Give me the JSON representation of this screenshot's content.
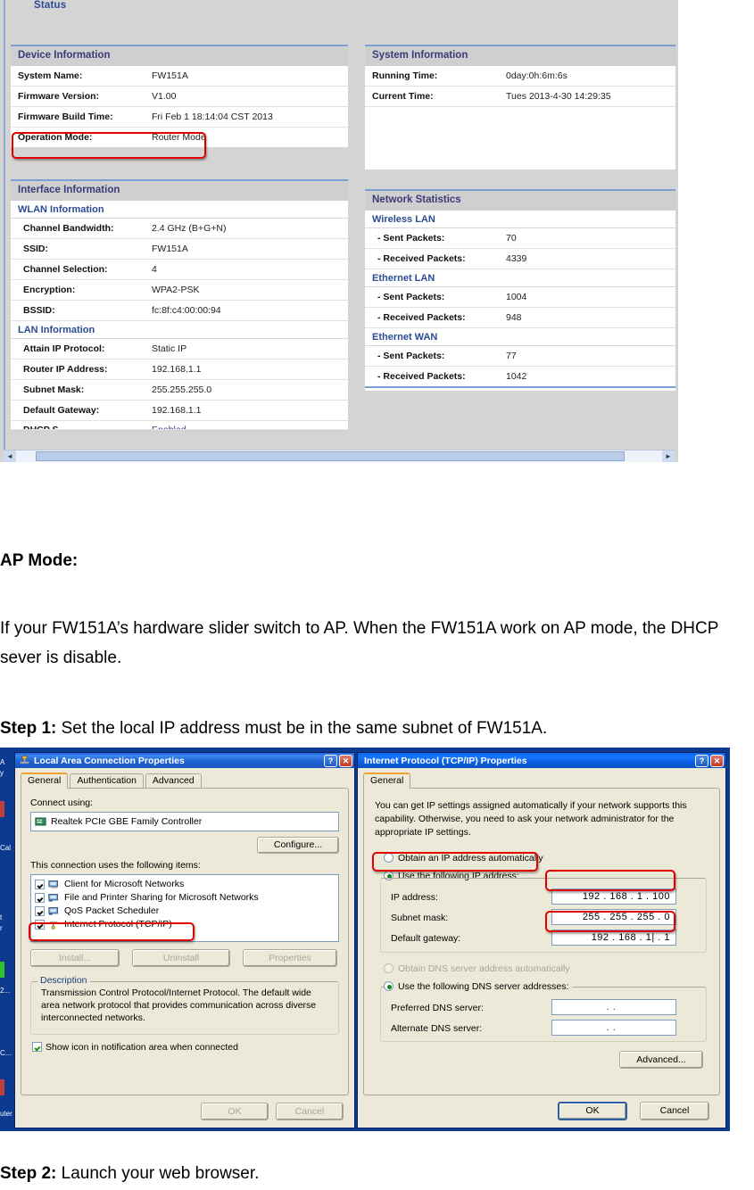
{
  "router": {
    "status_label": "Status",
    "device_information": {
      "header": "Device Information",
      "rows": [
        {
          "key": "System Name:",
          "value": "FW151A"
        },
        {
          "key": "Firmware Version:",
          "value": "V1.00"
        },
        {
          "key": "Firmware Build Time:",
          "value": "Fri Feb 1 18:14:04 CST  2013"
        },
        {
          "key": "Operation Mode:",
          "value": "Router Mode"
        }
      ]
    },
    "interface_information": {
      "header": "Interface Information",
      "wlan_subheader": "WLAN Information",
      "wlan_rows": [
        {
          "key": "Channel Bandwidth:",
          "value": "2.4 GHz (B+G+N)"
        },
        {
          "key": "SSID:",
          "value": "FW151A"
        },
        {
          "key": "Channel Selection:",
          "value": "4"
        },
        {
          "key": "Encryption:",
          "value": "WPA2-PSK"
        },
        {
          "key": "BSSID:",
          "value": "fc:8f:c4:00:00:94"
        }
      ],
      "lan_subheader": "LAN Information",
      "lan_rows": [
        {
          "key": "Attain IP Protocol:",
          "value": "Static IP"
        },
        {
          "key": "Router IP Address:",
          "value": "192.168.1.1"
        },
        {
          "key": "Subnet Mask:",
          "value": "255.255.255.0"
        },
        {
          "key": "Default Gateway:",
          "value": "192.168.1.1"
        }
      ],
      "cut_row": {
        "key": "DHCP S",
        "value": "Enabled"
      }
    },
    "system_information": {
      "header": "System Information",
      "rows": [
        {
          "key": "Running Time:",
          "value": "0day:0h:6m:6s"
        },
        {
          "key": "Current Time:",
          "value": "Tues 2013-4-30 14:29:35"
        }
      ]
    },
    "network_statistics": {
      "header": "Network Statistics",
      "groups": [
        {
          "name": "Wireless LAN",
          "rows": [
            {
              "key": "- Sent Packets:",
              "value": "70"
            },
            {
              "key": "- Received Packets:",
              "value": "4339"
            }
          ]
        },
        {
          "name": "Ethernet LAN",
          "rows": [
            {
              "key": "- Sent Packets:",
              "value": "1004"
            },
            {
              "key": "- Received Packets:",
              "value": "948"
            }
          ]
        },
        {
          "name": "Ethernet WAN",
          "rows": [
            {
              "key": "- Sent Packets:",
              "value": "77"
            },
            {
              "key": "- Received Packets:",
              "value": "1042"
            }
          ]
        }
      ]
    },
    "highlight_color": "#e00000"
  },
  "doc": {
    "ap_mode_heading": "AP Mode:",
    "ap_mode_paragraph": "If your FW151A’s hardware slider switch to AP. When the FW151A work on AP mode, the DHCP sever is disable.",
    "step1_label": "Step 1:",
    "step1_text": " Set the local IP address must be in the same subnet of FW151A.",
    "step2_label": "Step 2:",
    "step2_text": " Launch your web browser."
  },
  "desktop": {
    "icon_labels": [
      "A",
      "y",
      "Cal",
      "t",
      "r",
      "2...",
      "C...",
      "uter"
    ]
  },
  "lac_dialog": {
    "title": "Local Area Connection Properties",
    "icon": "network-plug-icon",
    "help_button": "?",
    "close_button": "✕",
    "tabs": [
      "General",
      "Authentication",
      "Advanced"
    ],
    "active_tab": "General",
    "connect_using_label": "Connect using:",
    "adapter_name": "Realtek PCIe GBE Family Controller",
    "configure_button": "Configure...",
    "items_label": "This connection uses the following items:",
    "items": [
      {
        "label": "Client for Microsoft Networks",
        "checked": true
      },
      {
        "label": "File and Printer Sharing for Microsoft Networks",
        "checked": true
      },
      {
        "label": "QoS Packet Scheduler",
        "checked": true
      },
      {
        "label": "Internet Protocol (TCP/IP)",
        "checked": true,
        "highlighted": true
      }
    ],
    "install_button": "Install...",
    "uninstall_button": "Uninstall",
    "properties_button": "Properties",
    "description_legend": "Description",
    "description_text": "Transmission Control Protocol/Internet Protocol. The default wide area network protocol that provides communication across diverse interconnected networks.",
    "show_icon_label": "Show icon in notification area when connected",
    "show_icon_checked": true,
    "ok_button": "OK",
    "cancel_button": "Cancel"
  },
  "tcpip_dialog": {
    "title": "Internet Protocol (TCP/IP) Properties",
    "help_button": "?",
    "close_button": "✕",
    "tabs": [
      "General"
    ],
    "active_tab": "General",
    "intro_text": "You can get IP settings assigned automatically if your network supports this capability. Otherwise, you need to ask your network administrator for the appropriate IP settings.",
    "radio_auto_ip": "Obtain an IP address automatically",
    "radio_manual_ip": "Use the following IP address:",
    "manual_ip_selected": true,
    "ip_address_label": "IP address:",
    "ip_address_value": "192 . 168 .   1  . 100",
    "subnet_mask_label": "Subnet mask:",
    "subnet_mask_value": "255 . 255 . 255 .   0",
    "default_gateway_label": "Default gateway:",
    "default_gateway_value": "192 . 168 .   1|  .   1",
    "radio_auto_dns": "Obtain DNS server address automatically",
    "radio_manual_dns": "Use the following DNS server addresses:",
    "manual_dns_selected": true,
    "preferred_dns_label": "Preferred DNS server:",
    "preferred_dns_value": ".    .",
    "alternate_dns_label": "Alternate DNS server:",
    "alternate_dns_value": ".    .",
    "advanced_button": "Advanced...",
    "ok_button": "OK",
    "cancel_button": "Cancel"
  }
}
